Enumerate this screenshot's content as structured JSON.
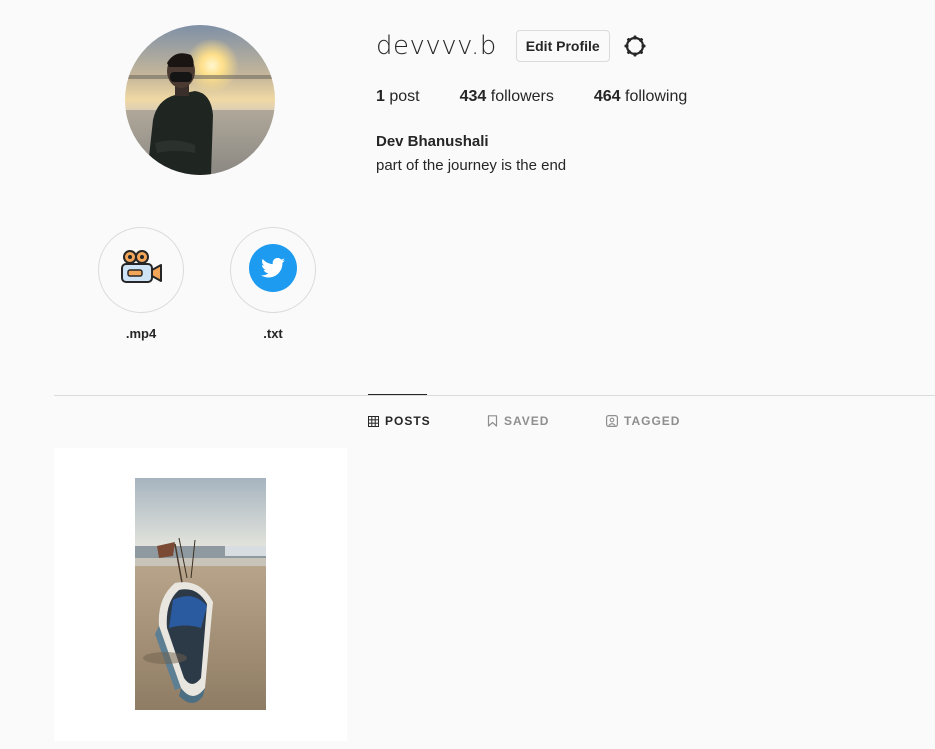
{
  "profile": {
    "username": "devvvv.b",
    "edit_profile_label": "Edit Profile",
    "settings_icon": "gear-icon",
    "stats": {
      "posts_count": "1",
      "posts_label": " post",
      "followers_count": "434",
      "followers_label": " followers",
      "following_count": "464",
      "following_label": " following"
    },
    "full_name": "Dev Bhanushali",
    "bio": "part of the journey is the end"
  },
  "highlights": [
    {
      "label": ".mp4",
      "icon": "video-camera-icon"
    },
    {
      "label": ".txt",
      "icon": "twitter-bird-icon"
    }
  ],
  "tabs": [
    {
      "label": "POSTS",
      "icon": "grid-icon",
      "active": true
    },
    {
      "label": "SAVED",
      "icon": "bookmark-icon",
      "active": false
    },
    {
      "label": "TAGGED",
      "icon": "tag-user-icon",
      "active": false
    }
  ],
  "colors": {
    "background": "#fafafa",
    "text": "#262626",
    "muted": "#8e8e8e",
    "border": "#dbdbdb",
    "twitter_blue": "#1d9bf0"
  }
}
